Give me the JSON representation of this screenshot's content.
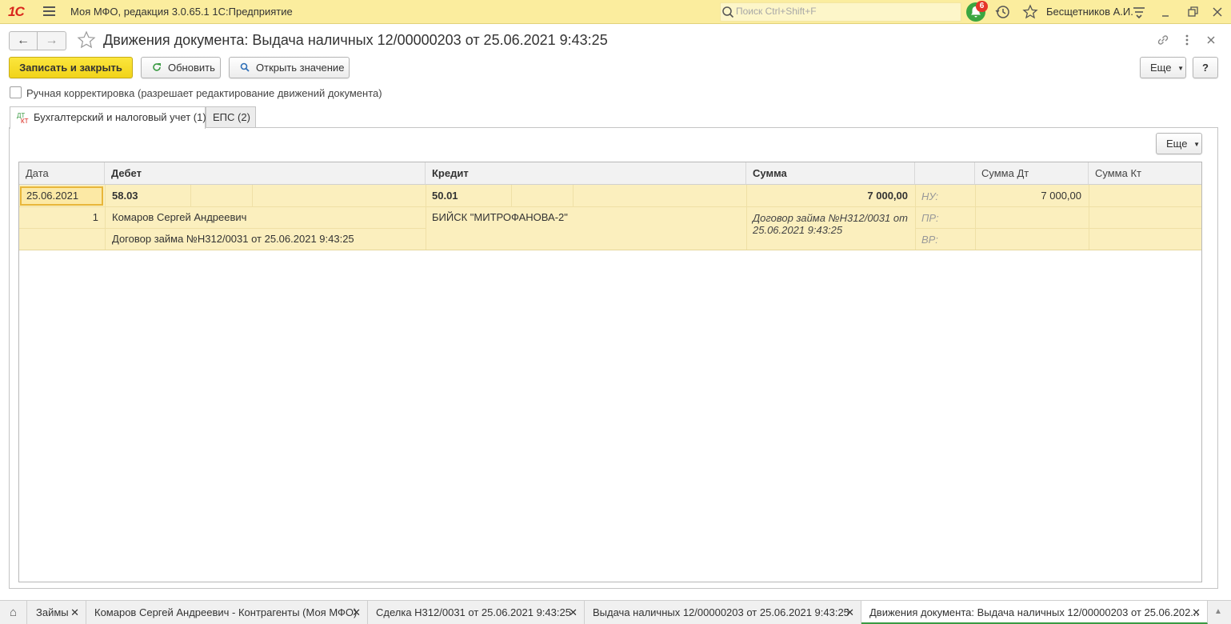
{
  "app": {
    "logo_text": "1С",
    "title": "Моя МФО, редакция 3.0.65.1 1С:Предприятие",
    "search_placeholder": "Поиск Ctrl+Shift+F",
    "notifications_count": "6",
    "user_name": "Бесщетников А.И."
  },
  "header": {
    "back": "←",
    "forward": "→",
    "title": "Движения документа: Выдача наличных 12/00000203 от 25.06.2021 9:43:25"
  },
  "toolbar": {
    "save_close": "Записать и закрыть",
    "refresh": "Обновить",
    "open_value": "Открыть значение",
    "more": "Еще",
    "help": "?"
  },
  "manual_correction": {
    "label": "Ручная корректировка (разрешает редактирование движений документа)",
    "checked": false
  },
  "tabs": [
    {
      "label": "Бухгалтерский и налоговый учет (1)",
      "active": true
    },
    {
      "label": "ЕПС (2)",
      "active": false
    }
  ],
  "table_toolbar": {
    "more": "Еще"
  },
  "table": {
    "columns": [
      "Дата",
      "Дебет",
      "Кредит",
      "Сумма",
      "",
      "Сумма Дт",
      "Сумма Кт"
    ],
    "rows": [
      {
        "date": "25.06.2021",
        "number": "1",
        "debit_account": "58.03",
        "debit_sub1": "Комаров Сергей Андреевич",
        "debit_sub2": "Договор займа №Н312/0031 от 25.06.2021 9:43:25",
        "credit_account": "50.01",
        "credit_sub1": "БИЙСК \"МИТРОФАНОВА-2\"",
        "amount": "7 000,00",
        "content_line1": "Договор займа №Н312/0031 от",
        "content_line2": "25.06.2021 9:43:25",
        "tax_labels": [
          "НУ:",
          "ПР:",
          "ВР:"
        ],
        "amount_dt": "7 000,00",
        "amount_kt": ""
      }
    ]
  },
  "taskbar": {
    "home": "⌂",
    "tabs": [
      "Займы",
      "Комаров Сергей Андреевич - Контрагенты (Моя МФО)",
      "Сделка Н312/0031 от 25.06.2021 9:43:25",
      "Выдача наличных 12/00000203 от 25.06.2021 9:43:25",
      "Движения документа: Выдача наличных 12/00000203 от 25.06.202..."
    ],
    "close": "✕"
  },
  "colors": {
    "topbar": "#fbed9e",
    "primary_button": "#f1d31a",
    "row_highlight": "#fbefbe",
    "notification_green": "#3aa640",
    "badge_red": "#e53629"
  }
}
